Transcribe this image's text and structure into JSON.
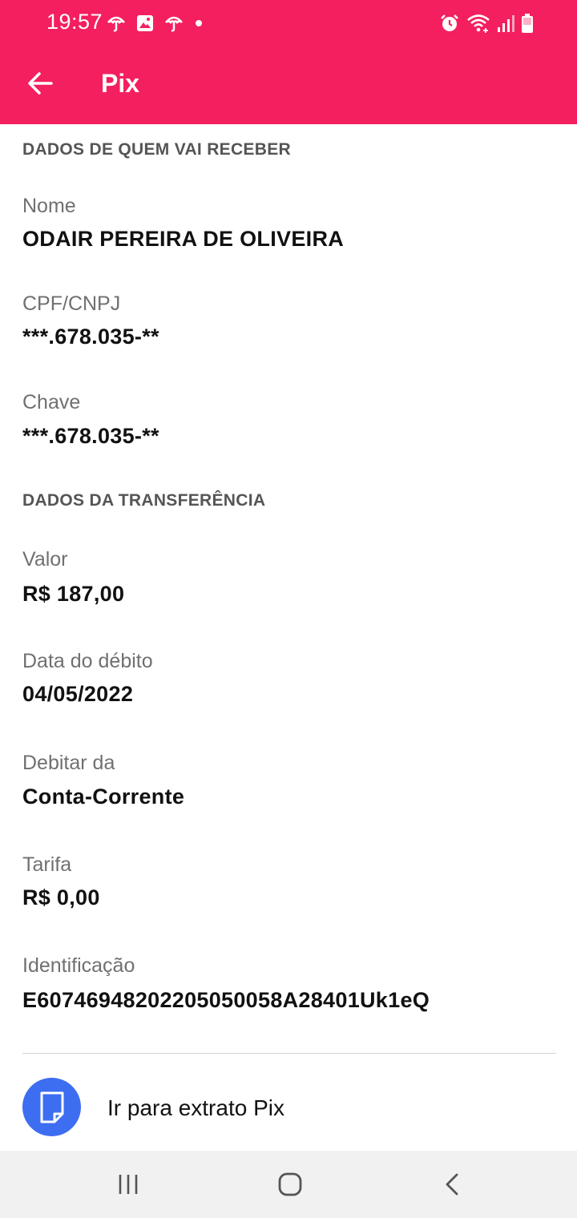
{
  "status_bar": {
    "time": "19:57",
    "left_icons": [
      "umbrella-notification-icon",
      "image-notification-icon",
      "umbrella-notification-icon",
      "dot-icon"
    ],
    "right_icons": [
      "alarm-icon",
      "wifi-icon",
      "signal-icon",
      "battery-icon"
    ]
  },
  "app_bar": {
    "title": "Pix",
    "color": "#f41f5e"
  },
  "recipient_section": {
    "header": "DADOS DE QUEM VAI RECEBER",
    "fields": [
      {
        "label": "Nome",
        "value": "ODAIR PEREIRA DE OLIVEIRA"
      },
      {
        "label": "CPF/CNPJ",
        "value": "***.678.035-**"
      },
      {
        "label": "Chave",
        "value": "***.678.035-**"
      }
    ]
  },
  "transfer_section": {
    "header": "DADOS DA TRANSFERÊNCIA",
    "fields": [
      {
        "label": "Valor",
        "value": "R$ 187,00"
      },
      {
        "label": "Data do débito",
        "value": "04/05/2022"
      },
      {
        "label": "Debitar da",
        "value": "Conta-Corrente"
      },
      {
        "label": "Tarifa",
        "value": "R$ 0,00"
      },
      {
        "label": "Identificação",
        "value": "E60746948202205050058A28401Uk1eQ"
      }
    ]
  },
  "extrato_link": {
    "label": "Ir para extrato Pix",
    "icon": "document-icon",
    "icon_color": "#3d6ef1"
  },
  "nav_bar": {
    "buttons": [
      "recent-apps-icon",
      "home-icon",
      "back-icon"
    ]
  }
}
